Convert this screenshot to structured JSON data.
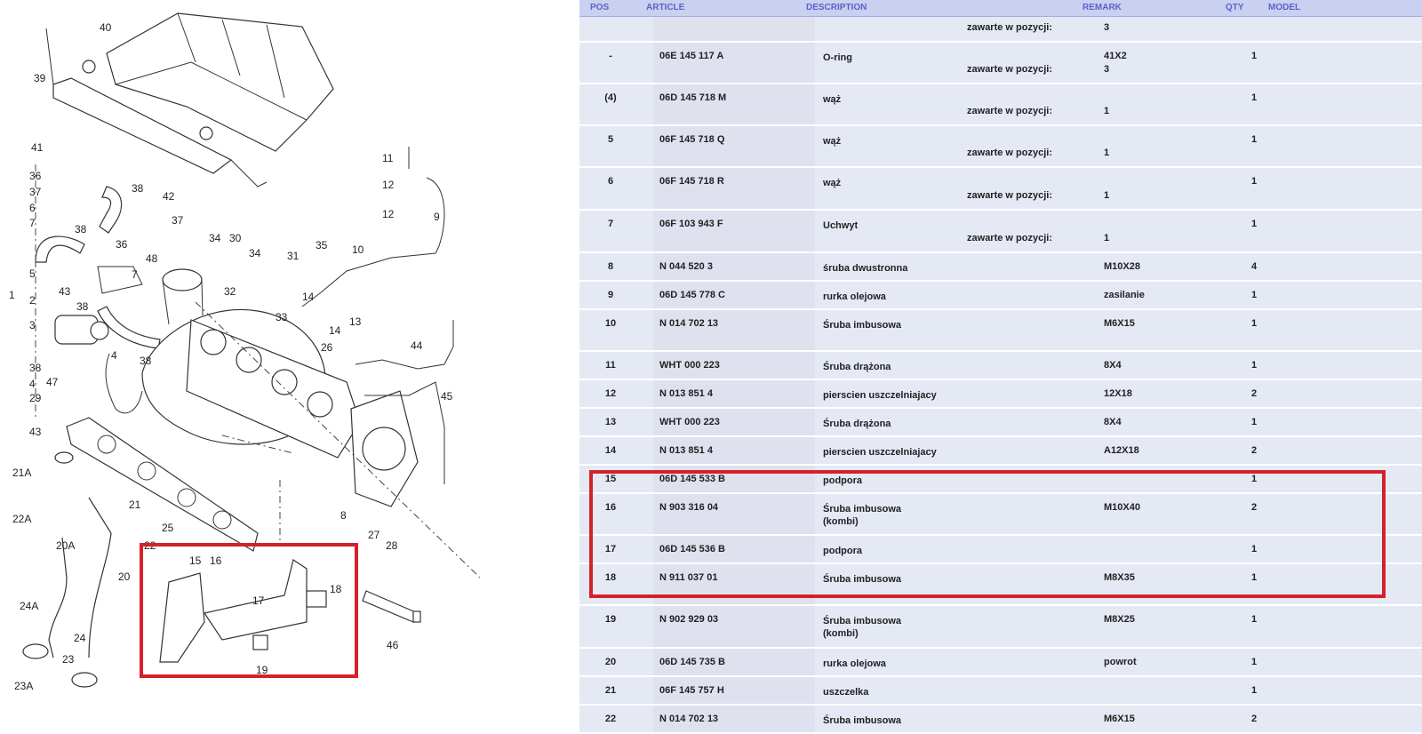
{
  "diagram": {
    "callouts": [
      "40",
      "39",
      "41",
      "36",
      "37",
      "6",
      "7",
      "5",
      "1",
      "2",
      "3",
      "38",
      "4",
      "29",
      "43",
      "38",
      "36",
      "37",
      "42",
      "34",
      "30",
      "34",
      "35",
      "31",
      "32",
      "33",
      "48",
      "47",
      "38",
      "26",
      "11",
      "12",
      "12",
      "9",
      "10",
      "14",
      "14",
      "13",
      "44",
      "45",
      "21A",
      "22A",
      "20A",
      "21",
      "22",
      "20",
      "25",
      "24A",
      "24",
      "23",
      "23A",
      "8",
      "27",
      "28",
      "15",
      "16",
      "17",
      "18",
      "19",
      "46"
    ],
    "highlight_color": "#d3222a"
  },
  "table": {
    "headers": {
      "pos": "POS",
      "article": "ARTICLE",
      "description": "DESCRIPTION",
      "remark": "REMARK",
      "qty": "QTY",
      "model": "MODEL"
    },
    "rows": [
      {
        "pos": "",
        "article": "",
        "description": "",
        "remark": "",
        "qty": "",
        "sub_label": "zawarte w pozycji:",
        "sub_value": "3"
      },
      {
        "pos": "-",
        "article": "06E 145 117 A",
        "description": "O-ring",
        "remark": "41X2",
        "qty": "1",
        "sub_label": "zawarte w pozycji:",
        "sub_value": "3"
      },
      {
        "pos": "(4)",
        "article": "06D 145 718 M",
        "description": "wąż",
        "remark": "",
        "qty": "1",
        "sub_label": "zawarte w pozycji:",
        "sub_value": "1"
      },
      {
        "pos": "5",
        "article": "06F 145 718 Q",
        "description": "wąż",
        "remark": "",
        "qty": "1",
        "sub_label": "zawarte w pozycji:",
        "sub_value": "1"
      },
      {
        "pos": "6",
        "article": "06F 145 718 R",
        "description": "wąż",
        "remark": "",
        "qty": "1",
        "sub_label": "zawarte w pozycji:",
        "sub_value": "1"
      },
      {
        "pos": "7",
        "article": "06F 103 943 F",
        "description": "Uchwyt",
        "remark": "",
        "qty": "1",
        "sub_label": "zawarte w pozycji:",
        "sub_value": "1"
      },
      {
        "pos": "8",
        "article": "N  044 520 3",
        "description": "śruba dwustronna",
        "remark": "M10X28",
        "qty": "4"
      },
      {
        "pos": "9",
        "article": "06D 145 778 C",
        "description": "rurka olejowa",
        "remark": "zasilanie",
        "qty": "1"
      },
      {
        "pos": "10",
        "article": "N  014 702 13",
        "description": "Śruba imbusowa",
        "remark": "M6X15",
        "qty": "1"
      },
      {
        "pos": "11",
        "article": "WHT 000 223",
        "description": "Śruba drążona",
        "remark": "8X4",
        "qty": "1"
      },
      {
        "pos": "12",
        "article": "N  013 851 4",
        "description": "pierscien uszczelniajacy",
        "remark": "12X18",
        "qty": "2"
      },
      {
        "pos": "13",
        "article": "WHT 000 223",
        "description": "Śruba drążona",
        "remark": "8X4",
        "qty": "1"
      },
      {
        "pos": "14",
        "article": "N  013 851 4",
        "description": "pierscien uszczelniajacy",
        "remark": "A12X18",
        "qty": "2"
      },
      {
        "pos": "15",
        "article": "06D 145 533 B",
        "description": "podpora",
        "remark": "",
        "qty": "1"
      },
      {
        "pos": "16",
        "article": "N  903 316 04",
        "description": "Śruba imbusowa",
        "description2": "(kombi)",
        "remark": "M10X40",
        "qty": "2"
      },
      {
        "pos": "17",
        "article": "06D 145 536 B",
        "description": "podpora",
        "remark": "",
        "qty": "1"
      },
      {
        "pos": "18",
        "article": "N  911 037 01",
        "description": "Śruba imbusowa",
        "remark": "M8X35",
        "qty": "1"
      },
      {
        "pos": "19",
        "article": "N  902 929 03",
        "description": "Śruba imbusowa",
        "description2": "(kombi)",
        "remark": "M8X25",
        "qty": "1"
      },
      {
        "pos": "20",
        "article": "06D 145 735 B",
        "description": "rurka olejowa",
        "remark": "powrot",
        "qty": "1"
      },
      {
        "pos": "21",
        "article": "06F 145 757 H",
        "description": "uszczelka",
        "remark": "",
        "qty": "1"
      },
      {
        "pos": "22",
        "article": "N  014 702 13",
        "description": "Śruba imbusowa",
        "remark": "M6X15",
        "qty": "2"
      }
    ]
  }
}
